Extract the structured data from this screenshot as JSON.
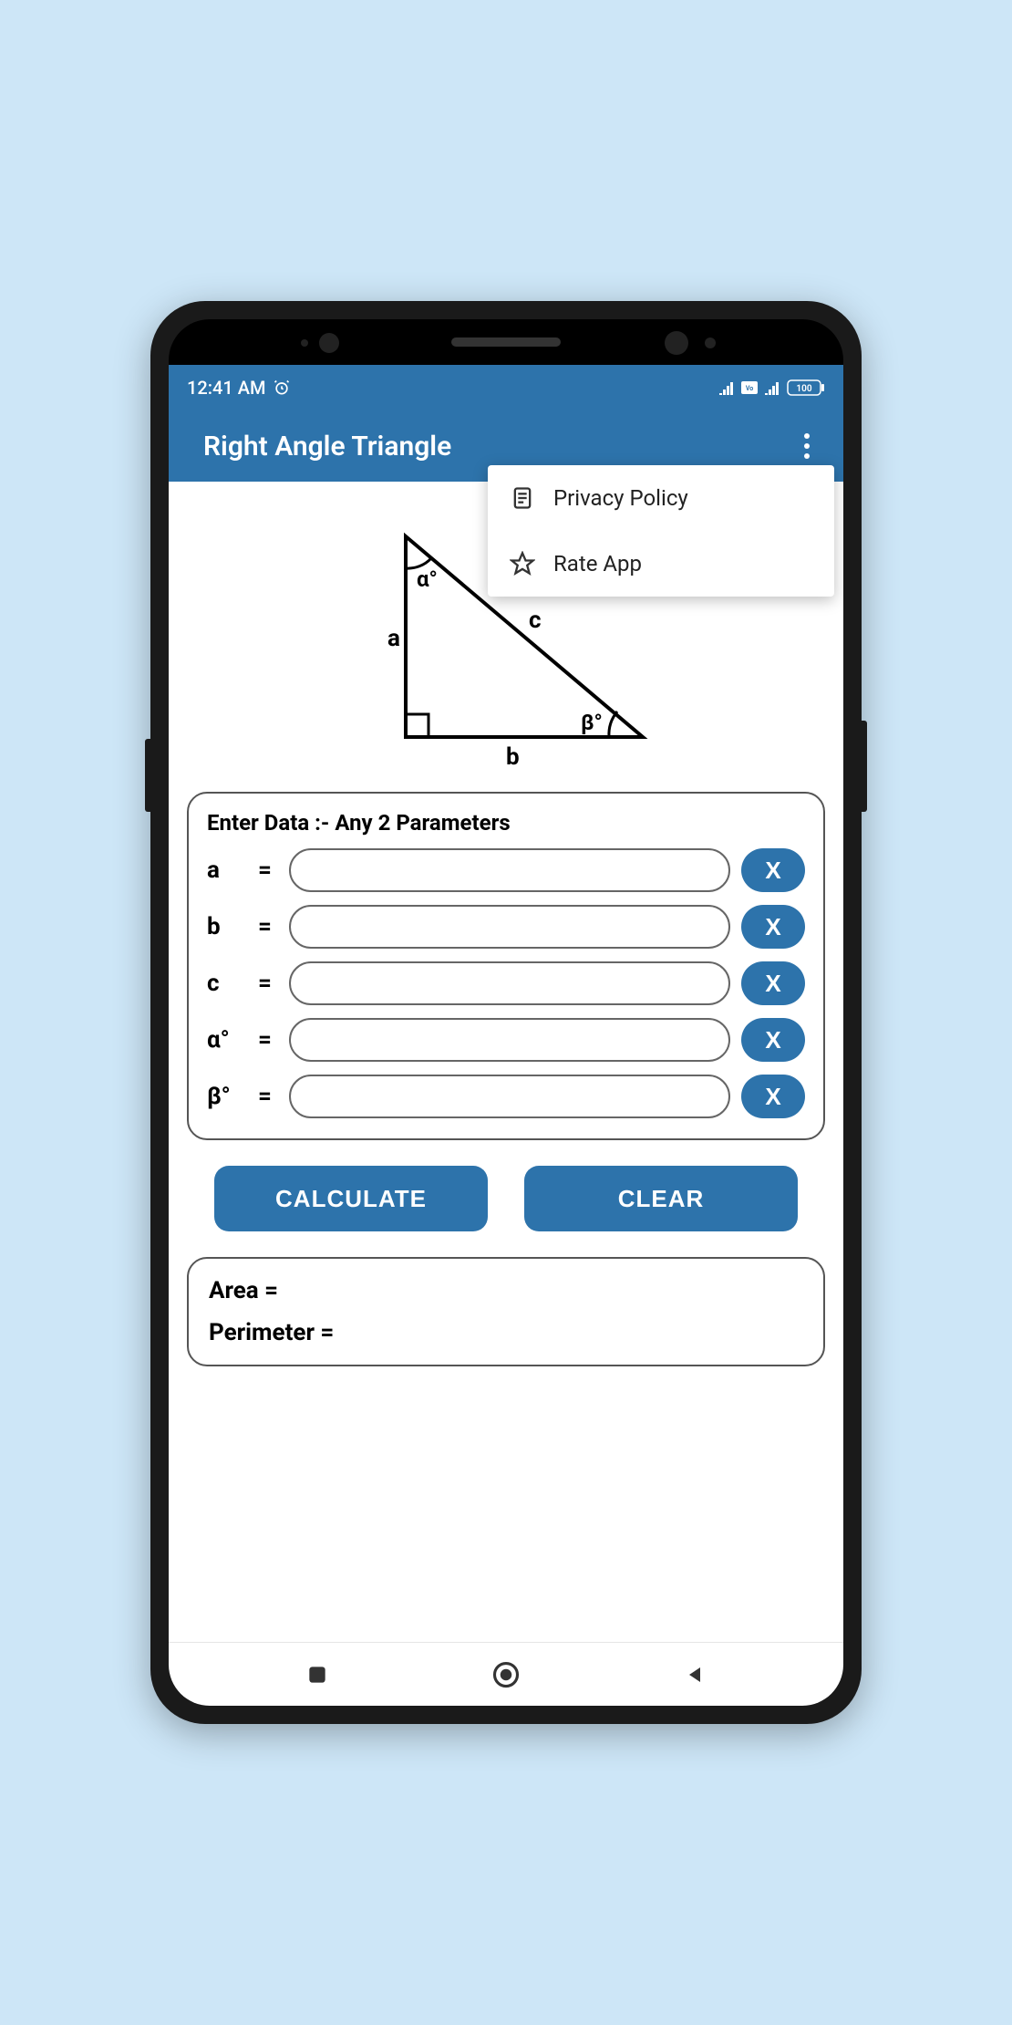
{
  "status": {
    "time": "12:41 AM",
    "battery": "100"
  },
  "app": {
    "title": "Right Angle Triangle"
  },
  "menu": {
    "items": [
      {
        "label": "Privacy Policy"
      },
      {
        "label": "Rate App"
      }
    ]
  },
  "diagram": {
    "side_a": "a",
    "side_b": "b",
    "side_c": "c",
    "angle_alpha": "α°",
    "angle_beta": "β°"
  },
  "form": {
    "title": "Enter Data :-  Any 2 Parameters",
    "eq": "=",
    "clear_x": "X",
    "fields": [
      {
        "label": "a",
        "value": ""
      },
      {
        "label": "b",
        "value": ""
      },
      {
        "label": "c",
        "value": ""
      },
      {
        "label": "α°",
        "value": ""
      },
      {
        "label": "β°",
        "value": ""
      }
    ]
  },
  "actions": {
    "calculate": "CALCULATE",
    "clear": "CLEAR"
  },
  "results": {
    "area": "Area =",
    "perimeter": "Perimeter ="
  }
}
